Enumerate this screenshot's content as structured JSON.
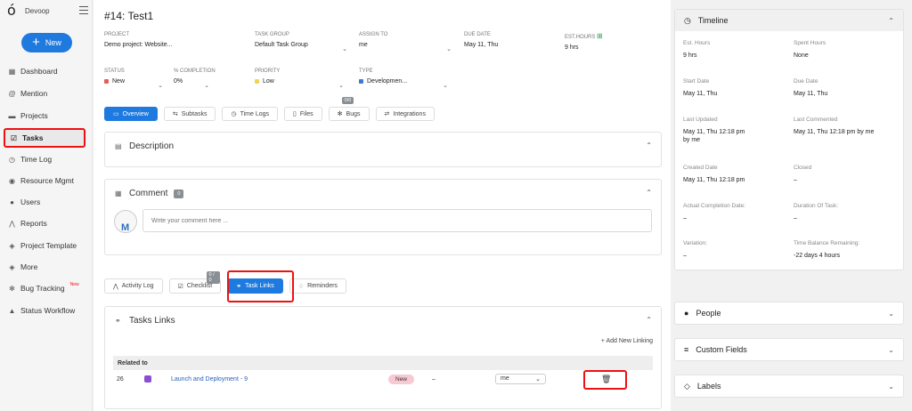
{
  "app": {
    "name": "Devoop",
    "new_label": "New"
  },
  "sidebar": {
    "items": [
      {
        "label": "Dashboard",
        "icon": "dashboard-icon",
        "glyph": "▦"
      },
      {
        "label": "Mention",
        "icon": "mention-icon",
        "glyph": "@"
      },
      {
        "label": "Projects",
        "icon": "briefcase-icon",
        "glyph": "▬"
      },
      {
        "label": "Tasks",
        "icon": "checkbox-icon",
        "glyph": "☑"
      },
      {
        "label": "Time Log",
        "icon": "clock-icon",
        "glyph": "◷"
      },
      {
        "label": "Resource Mgmt",
        "icon": "resource-icon",
        "glyph": "◉"
      },
      {
        "label": "Users",
        "icon": "user-icon",
        "glyph": "●"
      },
      {
        "label": "Reports",
        "icon": "chart-icon",
        "glyph": "⋀"
      },
      {
        "label": "Project Template",
        "icon": "layers-icon",
        "glyph": "◈"
      },
      {
        "label": "More",
        "icon": "more-icon",
        "glyph": "◈"
      },
      {
        "label": "Bug Tracking",
        "icon": "bug-icon",
        "glyph": "✻",
        "sup": "New"
      },
      {
        "label": "Status Workflow",
        "icon": "workflow-icon",
        "glyph": "▲"
      }
    ]
  },
  "task": {
    "title": "#14: Test1",
    "project_label": "PROJECT",
    "project": "Demo project: Website...",
    "group_label": "TASK GROUP",
    "group": "Default Task Group",
    "assign_label": "ASSIGN TO",
    "assign": "me",
    "due_label": "DUE DATE",
    "due": "May 11, Thu",
    "est_label": "EST.HOURS",
    "est": "9 hrs",
    "status_label": "STATUS",
    "status": "New",
    "completion_label": "% COMPLETION",
    "completion": "0%",
    "priority_label": "PRIORITY",
    "priority": "Low",
    "type_label": "TYPE",
    "type": "Developmen..."
  },
  "tabs": [
    {
      "label": "Overview",
      "icon": "overview-icon",
      "glyph": "▭"
    },
    {
      "label": "Subtasks",
      "icon": "subtasks-icon",
      "glyph": "⇆"
    },
    {
      "label": "Time Logs",
      "icon": "clock-icon",
      "glyph": "◷"
    },
    {
      "label": "Files",
      "icon": "file-icon",
      "glyph": "▯"
    },
    {
      "label": "Bugs",
      "icon": "bug-icon",
      "glyph": "✻",
      "badge": "0/0"
    },
    {
      "label": "Integrations",
      "icon": "integrations-icon",
      "glyph": "⇄"
    }
  ],
  "description": {
    "title": "Description"
  },
  "comment": {
    "title": "Comment",
    "count": "0",
    "placeholder": "Write your comment here ...",
    "avatar_letter": "M"
  },
  "tabs2": [
    {
      "label": "Activity Log",
      "icon": "activity-icon",
      "glyph": "⋀"
    },
    {
      "label": "Checklist",
      "icon": "checklist-icon",
      "glyph": "☑",
      "badge": "0 / 0"
    },
    {
      "label": "Task Links",
      "icon": "link-icon",
      "glyph": "⚭"
    },
    {
      "label": "Reminders",
      "icon": "bell-icon",
      "glyph": "♢"
    }
  ],
  "links": {
    "title": "Tasks Links",
    "add": "Add New Linking",
    "header": "Related to",
    "row": {
      "id": "26",
      "name": "Launch and Deployment - 9",
      "status": "New",
      "dash": "–",
      "assignee": "me"
    }
  },
  "timeline": {
    "title": "Timeline",
    "cells": [
      {
        "k": "Est. Hours",
        "v": "9 hrs"
      },
      {
        "k": "Spent Hours",
        "v": "None"
      },
      {
        "k": "Start Date",
        "v": "May 11, Thu"
      },
      {
        "k": "Due Date",
        "v": "May 11, Thu"
      },
      {
        "k": "Last Updated",
        "v": "May 11, Thu 12:18 pm",
        "v2": "by me"
      },
      {
        "k": "Last Commented",
        "v": "May 11, Thu 12:18 pm by me"
      },
      {
        "k": "Created Date",
        "v": "May 11, Thu 12:18 pm"
      },
      {
        "k": "Closed",
        "v": "–"
      },
      {
        "k": "Actual Completion Date:",
        "v": "–"
      },
      {
        "k": "Duration Of Task:",
        "v": "–"
      },
      {
        "k": "Variation:",
        "v": "–"
      },
      {
        "k": "Time Balance Remaining:",
        "v": "-22 days 4 hours"
      }
    ]
  },
  "panels": [
    {
      "title": "People",
      "icon": "user-icon",
      "glyph": "●"
    },
    {
      "title": "Custom Fields",
      "icon": "fields-icon",
      "glyph": "≡"
    },
    {
      "title": "Labels",
      "icon": "tag-icon",
      "glyph": "◇"
    }
  ],
  "colors": {
    "accent": "#1f7ae0",
    "highlight": "#e11111",
    "status_new": "#e35d5d",
    "priority_low": "#f0d552",
    "type": "#3a7bd5"
  }
}
